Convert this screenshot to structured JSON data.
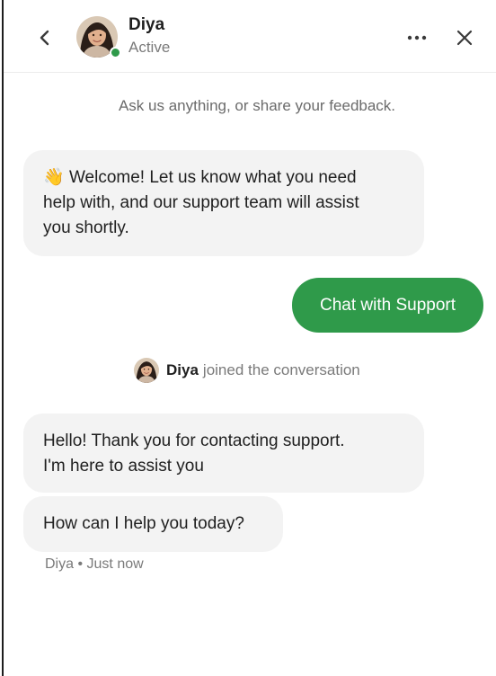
{
  "header": {
    "agent_name": "Diya",
    "agent_status": "Active",
    "back_icon": "chevron-left-icon",
    "more_icon": "more-horizontal-icon",
    "close_icon": "close-icon",
    "status_color": "#2f9a4a"
  },
  "intro_text": "Ask us anything, or share your feedback.",
  "messages": {
    "welcome": {
      "emoji": "👋",
      "line1": "Welcome! Let us know what you need",
      "line2": "help with, and our support team will assist",
      "line3": "you shortly."
    },
    "user_reply": "Chat with Support",
    "joined": {
      "name": "Diya",
      "text": "joined the conversation"
    },
    "hello": {
      "line1": "Hello! Thank you for contacting support.",
      "line2": "I'm here to assist you"
    },
    "help": "How can I help you today?",
    "meta": {
      "sender": "Diya",
      "separator": "•",
      "time": "Just now"
    }
  },
  "colors": {
    "accent": "#2f9a4a",
    "bubble_bg": "#f3f3f3",
    "muted_text": "#7a7a7a"
  }
}
